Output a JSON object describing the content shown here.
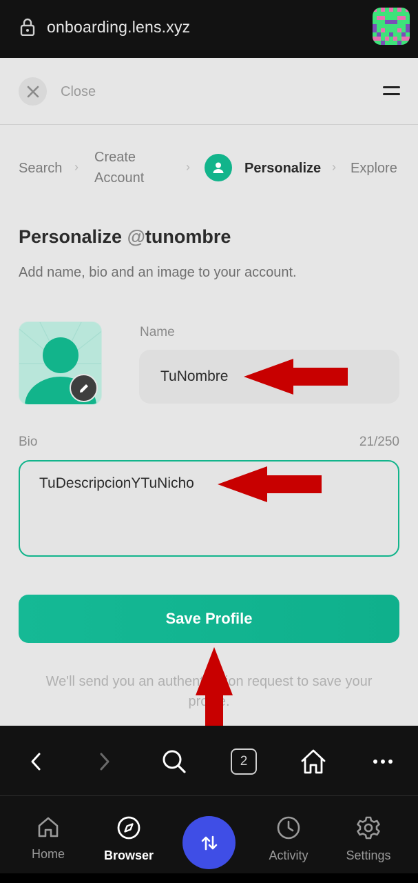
{
  "browser": {
    "url": "onboarding.lens.xyz"
  },
  "page": {
    "close_label": "Close",
    "steps": [
      {
        "label": "Search"
      },
      {
        "label": "Create Account"
      },
      {
        "label": "Personalize"
      },
      {
        "label": "Explore"
      }
    ],
    "title_prefix": "Personalize ",
    "title_at": "@",
    "title_handle": "tunombre",
    "subtitle": "Add name, bio and an image to your account.",
    "name_label": "Name",
    "name_value": "TuNombre",
    "bio_label": "Bio",
    "bio_count": "21/250",
    "bio_value": "TuDescripcionYTuNicho",
    "save_label": "Save Profile",
    "notice": "We'll send you an authentication request to save your profile."
  },
  "browserbar": {
    "tab_count": "2"
  },
  "bottomnav": {
    "items": [
      {
        "label": "Home",
        "icon": "home-icon"
      },
      {
        "label": "Browser",
        "icon": "compass-icon",
        "active": true
      },
      {
        "label": "Activity",
        "icon": "clock-icon"
      },
      {
        "label": "Settings",
        "icon": "gear-icon"
      }
    ]
  },
  "colors": {
    "accent": "#12b48b",
    "swap": "#3f4ee6",
    "annotation_arrow": "#c80000"
  }
}
